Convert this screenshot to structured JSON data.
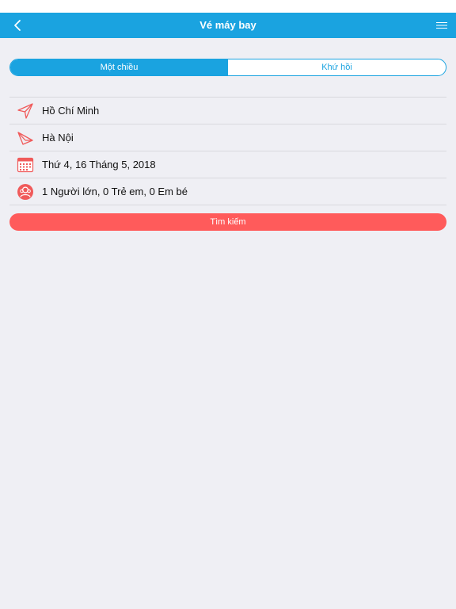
{
  "header": {
    "title": "Vé máy bay",
    "back_icon": "chevron-left-icon",
    "menu_icon": "hamburger-menu-icon"
  },
  "trip_type": {
    "options": [
      {
        "label": "Một chiều",
        "selected": true
      },
      {
        "label": "Khứ hồi",
        "selected": false
      }
    ]
  },
  "form": {
    "origin": "Hồ Chí Minh",
    "destination": "Hà Nội",
    "date": "Thứ 4, 16 Tháng 5, 2018",
    "passengers": "1 Người lớn, 0 Trẻ em, 0 Em bé"
  },
  "search_button": {
    "label": "Tìm kiếm"
  },
  "colors": {
    "accent": "#1aa3e0",
    "action": "#ff5b5b",
    "icon": "#f05a5a",
    "background": "#efeff4"
  }
}
